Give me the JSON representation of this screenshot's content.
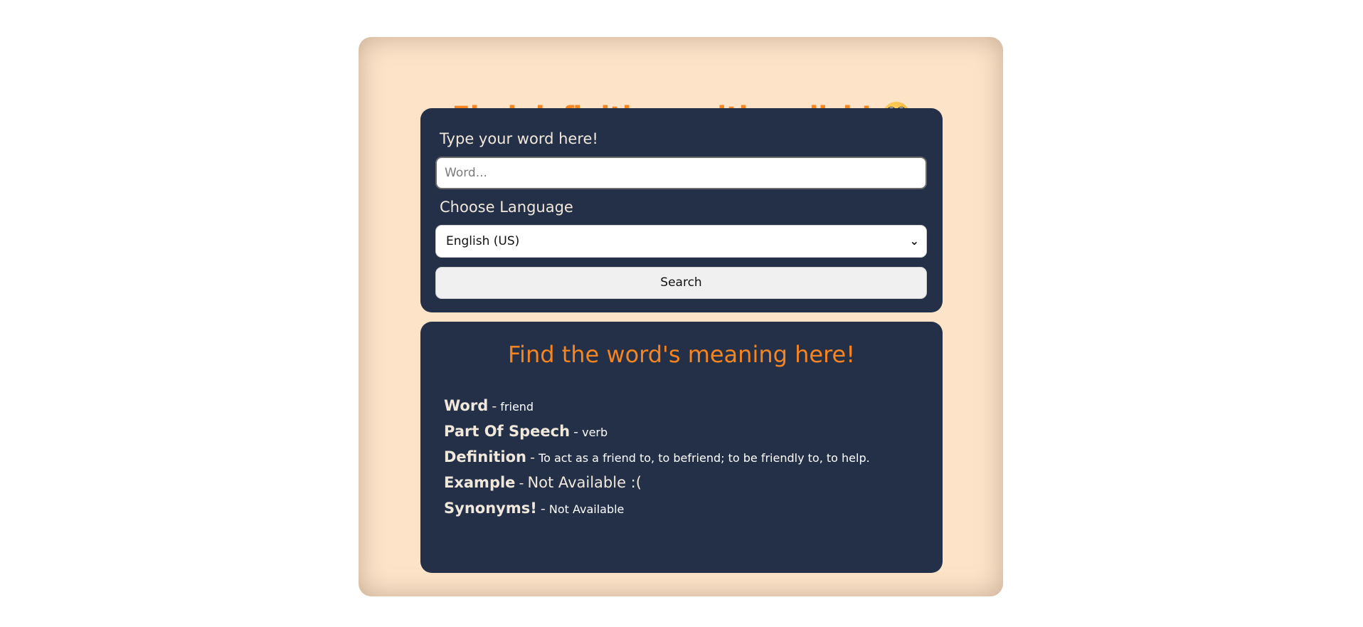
{
  "header": {
    "title": "Find definitions with a click!",
    "emoji_icon": "grinning-face-emoji-icon"
  },
  "form": {
    "word_label": "Type your word here!",
    "word_input": {
      "value": "",
      "placeholder": "Word..."
    },
    "language_label": "Choose Language",
    "language_selected": "English (US)",
    "search_label": "Search"
  },
  "result": {
    "title": "Find the word's meaning here!",
    "separator": "-",
    "rows": [
      {
        "key": "Word",
        "value": "friend"
      },
      {
        "key": "Part Of Speech",
        "value": "verb"
      },
      {
        "key": "Definition",
        "value": "To act as a friend to, to befriend; to be friendly to, to help."
      },
      {
        "key": "Example",
        "value": "Not Available :("
      },
      {
        "key": "Synonyms!",
        "value": "Not Available"
      }
    ]
  },
  "colors": {
    "accent": "#f6841f",
    "card_bg": "#233048",
    "page_bg": "#fde4c8"
  }
}
